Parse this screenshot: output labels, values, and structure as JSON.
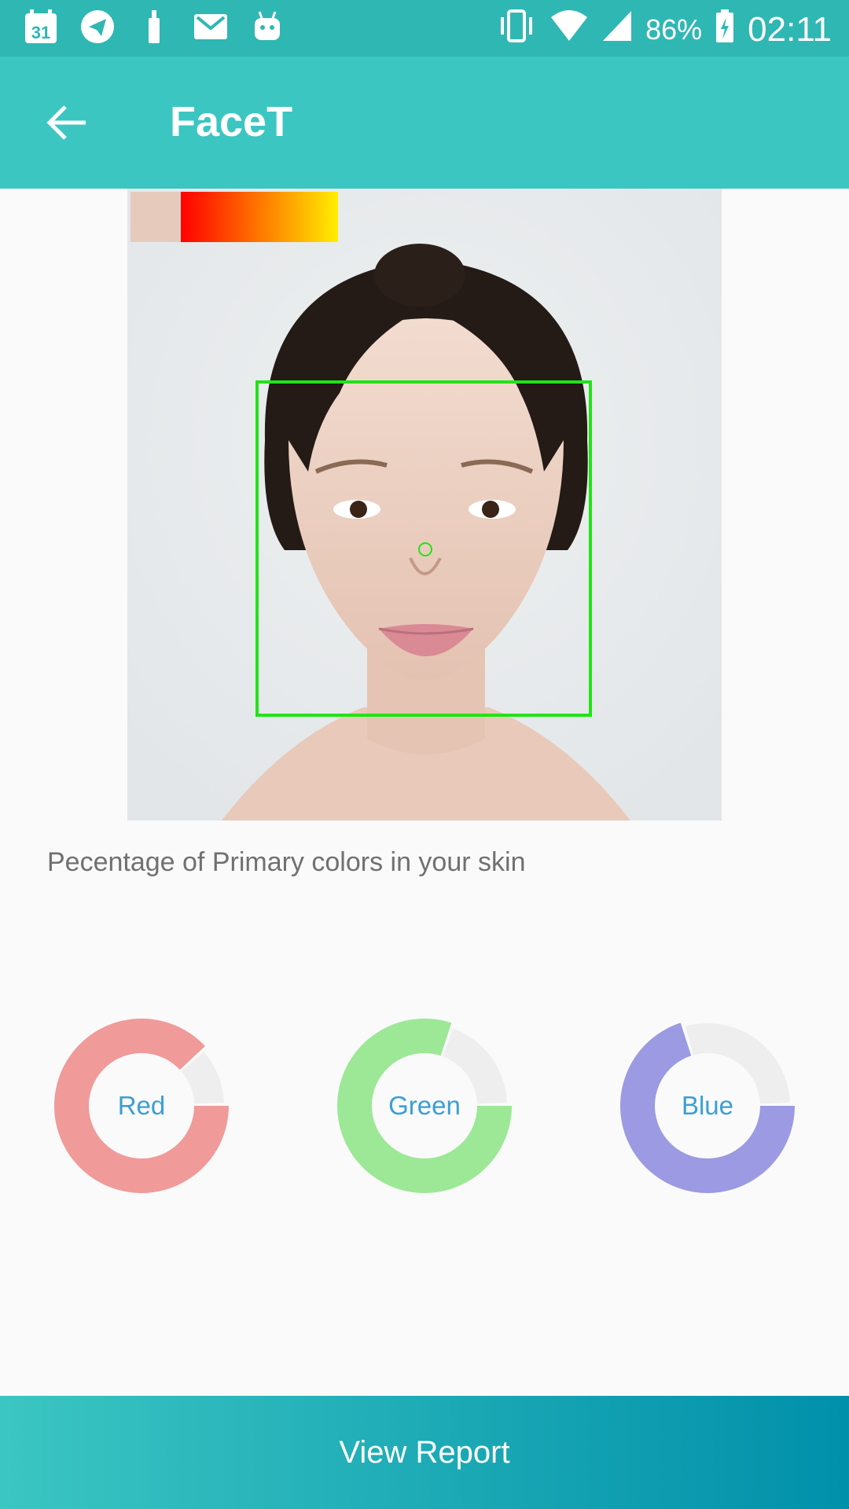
{
  "status_bar": {
    "calendar_day": "31",
    "battery": "86%",
    "time": "02:11",
    "left_icons": [
      "calendar-icon",
      "telegram-icon",
      "notification-icon",
      "gmail-icon",
      "android-icon"
    ],
    "right_icons": [
      "vibrate-icon",
      "wifi-icon",
      "signal-icon",
      "battery-charging-icon"
    ]
  },
  "app_bar": {
    "title": "FaceT",
    "back_icon": "arrow-back-icon",
    "color": "#3bc6c2"
  },
  "photo": {
    "palette": {
      "skin_tone": "#e6cbbd",
      "gradient_from": "#ff0000",
      "gradient_to": "#ffee00"
    },
    "face_box_color": "#21e317"
  },
  "caption": "Pecentage of Primary colors in your skin",
  "charts": {
    "red": {
      "label": "Red",
      "color": "#f09a9a",
      "fraction": 0.88
    },
    "green": {
      "label": "Green",
      "color": "#9de896",
      "fraction": 0.8
    },
    "blue": {
      "label": "Blue",
      "color": "#9b9ae2",
      "fraction": 0.7
    },
    "remainder_color": "#eeeeee"
  },
  "bottom_button": {
    "label": "View Report"
  }
}
